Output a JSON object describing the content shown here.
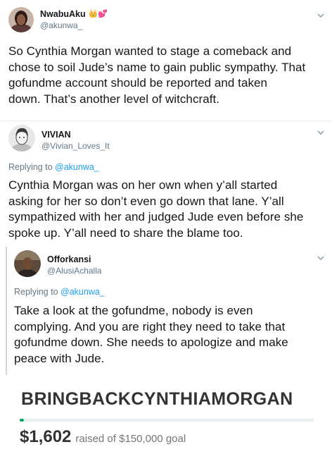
{
  "tweets": [
    {
      "name": "NwabuAku",
      "name_emoji": "👑💕",
      "handle": "@akunwa_",
      "text_lines": [
        "So Cynthia Morgan wanted to stage a comeback and",
        "chose to soil Jude’s name to gain public sympathy. That",
        "gofundme account should be reported and taken",
        "down. That’s  another level of witchcraft."
      ]
    },
    {
      "name": "VIVIAN",
      "handle": "@Vivian_Loves_It",
      "replying_prefix": "Replying to",
      "replying_to": "@akunwa_",
      "text_lines": [
        "Cynthia Morgan was on her own when y’all started",
        "asking for her so don’t even go down that lane. Y’all",
        "sympathized with her and judged Jude even before she",
        "spoke up. Y’all need to share the blame too."
      ]
    },
    {
      "name": "Offorkansi",
      "handle": "@AlusiAchalla",
      "replying_prefix": "Replying to",
      "replying_to": "@akunwa_",
      "text_lines": [
        "Take a look at the gofundme, nobody is even",
        "complying. And you are right they need to take that",
        "gofundme down. She needs to apologize and make",
        "peace with Jude."
      ]
    }
  ],
  "gofundme": {
    "title": "BRINGBACKCYNTHIAMORGAN",
    "amount": "$1,602",
    "goal_text": "raised of $150,000 goal",
    "progress_fraction": 0.0107,
    "accent": "#02a95c"
  },
  "icons": {
    "chevron": "chevron-down-icon"
  }
}
